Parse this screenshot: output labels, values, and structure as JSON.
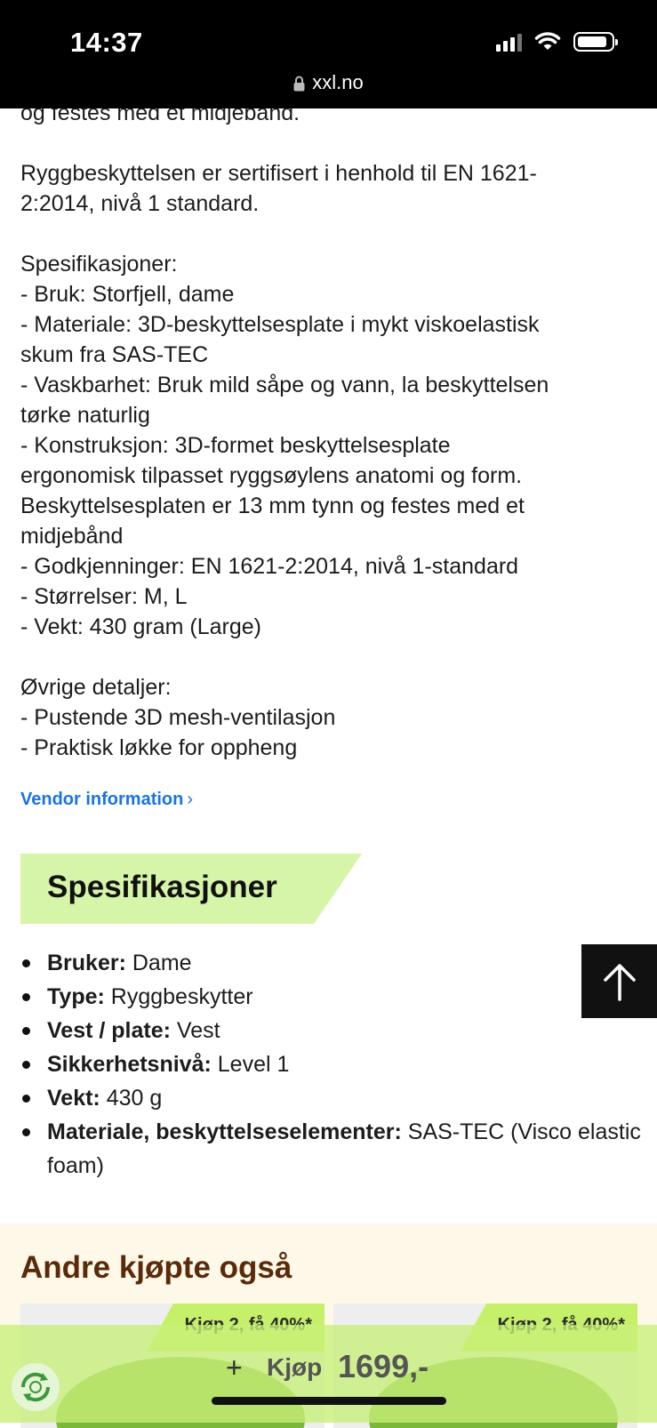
{
  "status_bar": {
    "time": "14:37",
    "url": "xxl.no",
    "icons": [
      "signal-icon",
      "wifi-icon",
      "battery-icon",
      "lock-icon"
    ]
  },
  "description": {
    "lines_block1": [
      "og festes med et midjebånd."
    ],
    "lines_block2": [
      "Ryggbeskyttelsen er sertifisert i henhold til EN 1621-",
      "2:2014, nivå 1 standard."
    ],
    "lines_block3": [
      "Spesifikasjoner:",
      "- Bruk: Storfjell, dame",
      "- Materiale: 3D-beskyttelsesplate i mykt viskoelastisk",
      "skum fra SAS-TEC",
      "- Vaskbarhet: Bruk mild såpe og vann, la beskyttelsen",
      "tørke naturlig",
      "- Konstruksjon: 3D-formet beskyttelsesplate",
      "ergonomisk tilpasset ryggsøylens anatomi og form.",
      "Beskyttelsesplaten er 13 mm tynn og festes med et",
      "midjebånd",
      "- Godkjenninger: EN 1621-2:2014, nivå 1-standard",
      "- Størrelser: M, L",
      "- Vekt: 430 gram (Large)"
    ],
    "lines_block4": [
      "Øvrige detaljer:",
      "- Pustende 3D mesh-ventilasjon",
      "- Praktisk løkke for oppheng"
    ]
  },
  "vendor_link": {
    "label": "Vendor information",
    "chevron": "›"
  },
  "specs": {
    "title": "Spesifikasjoner",
    "items": [
      {
        "key": "Bruker:",
        "value": " Dame"
      },
      {
        "key": "Type:",
        "value": " Ryggbeskytter"
      },
      {
        "key": "Vest / plate:",
        "value": " Vest"
      },
      {
        "key": "Sikkerhetsnivå:",
        "value": " Level 1"
      },
      {
        "key": "Vekt:",
        "value": " 430 g"
      },
      {
        "key": "Materiale, beskyttelseselementer:",
        "value": " SAS-TEC (Visco elastic foam)"
      }
    ]
  },
  "also_bought": {
    "title": "Andre kjøpte også",
    "products": [
      {
        "badge": "Kjøp 2, få 40%*"
      },
      {
        "badge": "Kjøp 2, få 40%*"
      }
    ]
  },
  "buy_bar": {
    "plus": "+",
    "label": "Kjøp",
    "price": "1699,-"
  },
  "colors": {
    "accent_green": "#d6f5a8",
    "badge_green": "#c6f06a",
    "link_blue": "#1a73e8",
    "brown_title": "#5a2a0a"
  }
}
